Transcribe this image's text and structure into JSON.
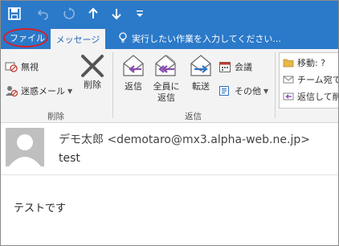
{
  "tabs": {
    "file": "ファイル",
    "message": "メッセージ",
    "tell_me": "実行したい作業を入力してください..."
  },
  "ribbon": {
    "delete_group": {
      "ignore": "無視",
      "junk": "迷惑メール",
      "delete": "削除",
      "label": "削除"
    },
    "respond_group": {
      "reply": "返信",
      "reply_all_line1": "全員に",
      "reply_all_line2": "返信",
      "forward": "転送",
      "meeting": "会議",
      "more": "その他",
      "label": "返信"
    },
    "quick_steps": {
      "move": "移動: ?",
      "team_email": "チーム宛て",
      "reply_delete": "返信して削"
    }
  },
  "message": {
    "sender": "デモ太郎 <demotaro@mx3.alpha-web.ne.jp>",
    "subject": "test",
    "body": "テストです"
  },
  "colors": {
    "title_blue": "#2b79c9",
    "ribbon_bg": "#f3f3f3",
    "highlight_circle": "#d4202a",
    "reply_purple": "#8a4bb0",
    "forward_blue": "#2f72c4"
  }
}
